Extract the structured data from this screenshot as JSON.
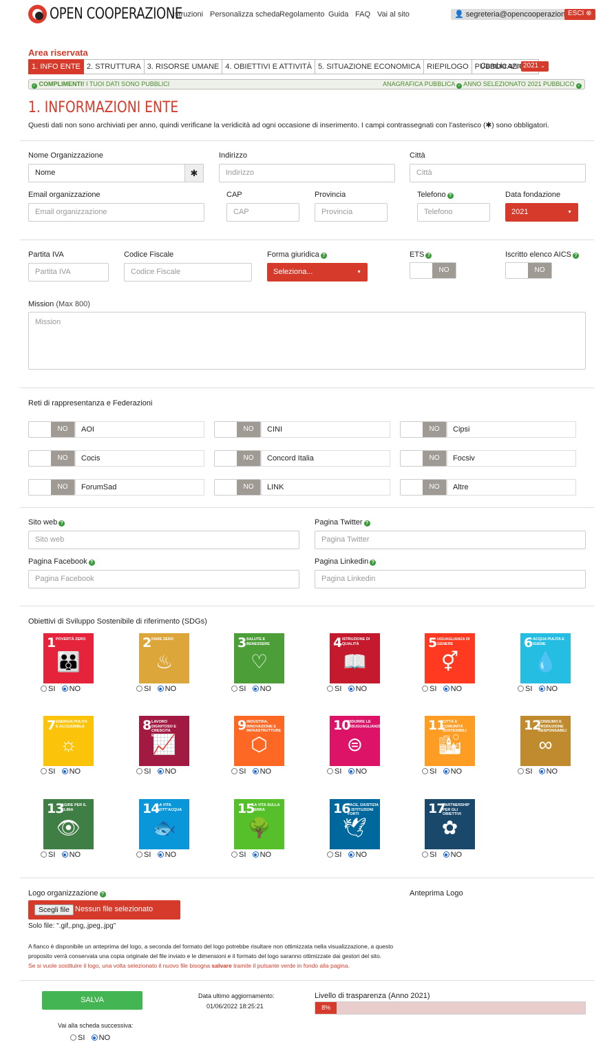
{
  "header": {
    "logo_text": "OPEN COOPERAZIONE",
    "nav": [
      "Istruzioni",
      "Personalizza scheda",
      "Regolamento",
      "Guida",
      "FAQ",
      "Vai al sito"
    ],
    "user_email": "segreteria@opencooperazione.it",
    "logout_label": "ESCI"
  },
  "area_title": "Area riservata",
  "tabs": [
    "1. INFO ENTE",
    "2. STRUTTURA",
    "3. RISORSE UMANE",
    "4. OBIETTIVI E ATTIVITÀ",
    "5. SITUAZIONE ECONOMICA",
    "RIEPILOGO",
    "PUBBLICAZIONE"
  ],
  "year": {
    "label": "Cambia anno:",
    "value": "2021"
  },
  "status": {
    "left_strong": "COMPLIMENTI!",
    "left_rest": " I TUOI DATI SONO PUBBLICI",
    "right_a": "ANAGRAFICA PUBBLICA",
    "right_b": "ANNO SELEZIONATO 2021 PUBBLICO"
  },
  "page_title": "1. INFORMAZIONI ENTE",
  "intro": "Questi dati non sono archiviati per anno, quindi verificane la veridicità ad ogni occasione di inserimento. I campi contrassegnati con l'asterisco (✱) sono obbligatori.",
  "fields": {
    "nome": {
      "label": "Nome Organizzazione",
      "value": "Nome"
    },
    "indirizzo": {
      "label": "Indirizzo",
      "placeholder": "Indirizzo"
    },
    "citta": {
      "label": "Città",
      "placeholder": "Città"
    },
    "email": {
      "label": "Email organizzazione",
      "placeholder": "Email organizzazione"
    },
    "cap": {
      "label": "CAP",
      "placeholder": "CAP"
    },
    "provincia": {
      "label": "Provincia",
      "placeholder": "Provincia"
    },
    "telefono": {
      "label": "Telefono",
      "placeholder": "Telefono"
    },
    "fondazione": {
      "label": "Data fondazione",
      "value": "2021"
    },
    "piva": {
      "label": "Partita IVA",
      "placeholder": "Partita IVA"
    },
    "cf": {
      "label": "Codice Fiscale",
      "placeholder": "Codice Fiscale"
    },
    "forma": {
      "label": "Forma giuridica",
      "value": "Seleziona..."
    },
    "ets": {
      "label": "ETS",
      "value": "NO"
    },
    "aics": {
      "label": "Iscritto elenco AICS",
      "value": "NO"
    },
    "mission": {
      "label": "Mission",
      "hint": " (Max 800)",
      "placeholder": "Mission"
    }
  },
  "networks": {
    "title": "Reti di rappresentanza e Federazioni",
    "toggle_label": "NO",
    "items": [
      "AOI",
      "CINI",
      "Cipsi",
      "Cocis",
      "Concord Italia",
      "Focsiv",
      "ForumSad",
      "LINK",
      "Altre"
    ]
  },
  "social": {
    "sito": {
      "label": "Sito web",
      "placeholder": "Sito web"
    },
    "twitter": {
      "label": "Pagina Twitter",
      "placeholder": "Pagina Twitter"
    },
    "facebook": {
      "label": "Pagina Facebook",
      "placeholder": "Pagina Facebook"
    },
    "linkedin": {
      "label": "Pagina Linkedin",
      "placeholder": "Pagina Linkedin"
    }
  },
  "sdgs": {
    "title": "Obiettivi di Sviluppo Sostenibile di riferimento (SDGs)",
    "yes_label": "SI",
    "no_label": "NO",
    "items": [
      {
        "num": "1",
        "text": "POVERTÀ ZERO",
        "color": "#e5243b",
        "icon": "people-icon",
        "glyph": "👪"
      },
      {
        "num": "2",
        "text": "FAME ZERO",
        "color": "#dda63a",
        "icon": "bowl-icon",
        "glyph": "♨"
      },
      {
        "num": "3",
        "text": "SALUTE E BENESSERE",
        "color": "#4c9f38",
        "icon": "heartbeat-icon",
        "glyph": "♡"
      },
      {
        "num": "4",
        "text": "ISTRUZIONE DI QUALITÀ",
        "color": "#c5192d",
        "icon": "book-icon",
        "glyph": "📖"
      },
      {
        "num": "5",
        "text": "UGUAGLIANZA DI GENERE",
        "color": "#ff3a21",
        "icon": "gender-icon",
        "glyph": "⚥"
      },
      {
        "num": "6",
        "text": "ACQUA PULITA E IGIENE",
        "color": "#26bde2",
        "icon": "water-icon",
        "glyph": "💧"
      },
      {
        "num": "7",
        "text": "ENERGIA PULITA E ACCESSIBILE",
        "color": "#fcc30b",
        "icon": "sun-power-icon",
        "glyph": "☼"
      },
      {
        "num": "8",
        "text": "LAVORO DIGNITOSO E CRESCITA ECONOMICA",
        "color": "#a21942",
        "icon": "growth-chart-icon",
        "glyph": "📈"
      },
      {
        "num": "9",
        "text": "INDUSTRIA, INNOVAZIONE E INFRASTRUTTURE",
        "color": "#fd6925",
        "icon": "cubes-icon",
        "glyph": "⬡"
      },
      {
        "num": "10",
        "text": "RIDURRE LE DISUGUAGLIANZE",
        "color": "#dd1367",
        "icon": "equal-icon",
        "glyph": "⊜"
      },
      {
        "num": "11",
        "text": "CITTÀ E COMUNITÀ SOSTENIBILI",
        "color": "#fd9d24",
        "icon": "city-icon",
        "glyph": "🏙"
      },
      {
        "num": "12",
        "text": "CONSUMO E PRODUZIONE RESPONSABILI",
        "color": "#bf8b2e",
        "icon": "infinity-icon",
        "glyph": "∞"
      },
      {
        "num": "13",
        "text": "AGIRE PER IL CLIMA",
        "color": "#3f7e44",
        "icon": "eye-globe-icon",
        "glyph": "👁"
      },
      {
        "num": "14",
        "text": "LA VITA SOTT'ACQUA",
        "color": "#0a97d9",
        "icon": "fish-icon",
        "glyph": "🐟"
      },
      {
        "num": "15",
        "text": "LA VITA SULLA TERRA",
        "color": "#56c02b",
        "icon": "tree-icon",
        "glyph": "🌳"
      },
      {
        "num": "16",
        "text": "PACE, GIUSTIZIA E ISTITUZIONI FORTI",
        "color": "#00689d",
        "icon": "dove-icon",
        "glyph": "🕊"
      },
      {
        "num": "17",
        "text": "PARTNERSHIP PER GLI OBIETTIVI",
        "color": "#19486a",
        "icon": "rings-icon",
        "glyph": "✿"
      }
    ]
  },
  "logo": {
    "label": "Logo organizzazione",
    "preview_label": "Anteprima Logo",
    "button": "Scegli file",
    "no_file": "Nessun file selezionato",
    "formats": "Solo file: \".gif,.png,.jpeg,.jpg\"",
    "note1": "A fianco è disponibile un anteprima del logo, a seconda del formato del logo potrebbe risultare non ottimizzata nella visualizzazione, a questo",
    "note2": "proposito verrà conservata una copia originale del file inviato e le dimensioni e il formato del logo saranno ottimizzate dai gestori del sito.",
    "note3a": "Se si vuole sostituire il logo, una volta selezionato il nuovo file bisogna ",
    "note3b": "salvare",
    "note3c": " tramite il pulsante verde in fondo alla pagina."
  },
  "footer": {
    "save": "SALVA",
    "updated_label": "Data ultimo aggiornamento:",
    "updated_value": "01/06/2022 18:25:21",
    "transparency_label": "Livello di trasparenza (Anno 2021)",
    "transparency_value": 8,
    "transparency_text": "8%",
    "next_label": "Vai alla scheda successiva:",
    "next_yes": "SI",
    "next_no": "NO"
  },
  "colors": {
    "accent": "#d63a2a",
    "success": "#43b553",
    "help": "#3a9a3a"
  }
}
